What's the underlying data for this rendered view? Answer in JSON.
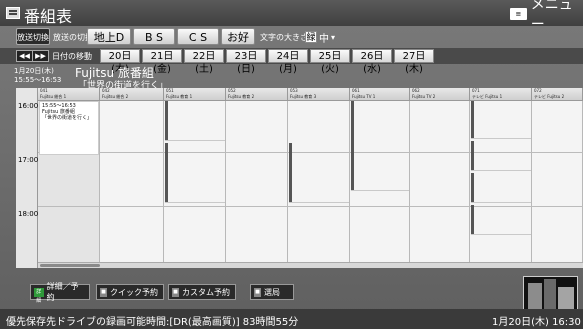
{
  "header": {
    "title": "番組表",
    "menu_icon": "メニュー",
    "menu_label": "メニュー"
  },
  "controls": {
    "broadcast_switch": "放送切換",
    "broadcast_label": "放送の切換",
    "tabs": [
      "地上D",
      "B S",
      "C S",
      "お好み"
    ],
    "font_size_label": "文字の大きさ :",
    "font_size_value": "中"
  },
  "date_nav": {
    "label": "日付の移動",
    "dates": [
      "20日(木)",
      "21日(金)",
      "22日(土)",
      "23日(日)",
      "24日(月)",
      "25日(火)",
      "26日(水)",
      "27日(木)"
    ]
  },
  "selected_program": {
    "date": "1月20日(木)",
    "time": "15:55～16:53",
    "title": "Fujitsu 旅番組",
    "subtitle": "「世界の街道を行く」"
  },
  "grid": {
    "times": [
      "16:00",
      "17:00",
      "18:00"
    ],
    "channels": [
      {
        "num": "041",
        "name": "Fujitsu 総合 1"
      },
      {
        "num": "042",
        "name": "Fujitsu 総合 2"
      },
      {
        "num": "051",
        "name": "Fujitsu 教育 1"
      },
      {
        "num": "052",
        "name": "Fujitsu 教育 2"
      },
      {
        "num": "053",
        "name": "Fujitsu 教育 3"
      },
      {
        "num": "061",
        "name": "Fujitsu TV 1"
      },
      {
        "num": "062",
        "name": "Fujitsu TV 2"
      },
      {
        "num": "071",
        "name": "テレビ Fujitsu 1"
      },
      {
        "num": "072",
        "name": "テレビ Fujitsu 2"
      }
    ],
    "selected_cell": {
      "time": "15:55～16:53",
      "title": "Fujitsu 旅番組",
      "subtitle": "「世界の街道を行く」"
    }
  },
  "bottom_buttons": [
    {
      "key": "詳細",
      "label": "詳細／予約"
    },
    {
      "key": "■",
      "label": "クイック予約"
    },
    {
      "key": "■",
      "label": "カスタム予約"
    },
    {
      "key": "■",
      "label": "選局"
    }
  ],
  "status": {
    "left": "優先保存先ドライブの録画可能時間:[DR(最高画質)] 83時間55分",
    "right": "1月20日(木) 16:30"
  }
}
